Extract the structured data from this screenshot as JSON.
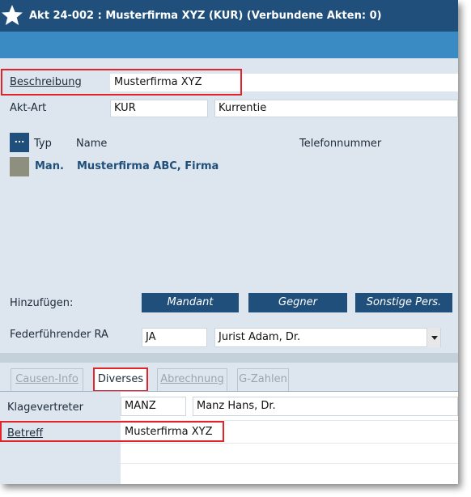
{
  "header": {
    "title": "Akt 24-002 : Musterfirma XYZ (KUR) (Verbundene Akten: 0)"
  },
  "form": {
    "beschreibung_label": "Beschreibung",
    "beschreibung_value": "Musterfirma XYZ",
    "aktart_label": "Akt-Art",
    "aktart_code": "KUR",
    "aktart_name": "Kurrentie"
  },
  "parties": {
    "more_button": "...",
    "columns": {
      "typ": "Typ",
      "name": "Name",
      "telefon": "Telefonnummer"
    },
    "rows": [
      {
        "typ": "Man.",
        "name": "Musterfirma ABC, Firma",
        "telefon": ""
      }
    ]
  },
  "add": {
    "label": "Hinzufügen:",
    "buttons": [
      "Mandant",
      "Gegner",
      "Sonstige Pers."
    ]
  },
  "federfuehrend": {
    "label": "Federführender RA",
    "code": "JA",
    "name": "Jurist Adam, Dr."
  },
  "tabs": [
    "Causen-Info",
    "Diverses",
    "Abrechnung",
    "G-Zahlen"
  ],
  "active_tab": "Diverses",
  "diverses": {
    "klagevertreter_label": "Klagevertreter",
    "klagevertreter_code": "MANZ",
    "klagevertreter_name": "Manz Hans, Dr.",
    "betreff_label": "Betreff",
    "betreff_value": "Musterfirma XYZ"
  },
  "colors": {
    "titlebar": "#1f4f7a",
    "subbar": "#3a8ac4",
    "panel": "#dde6ee",
    "highlight": "#e0242a",
    "button": "#1f4f7a"
  }
}
